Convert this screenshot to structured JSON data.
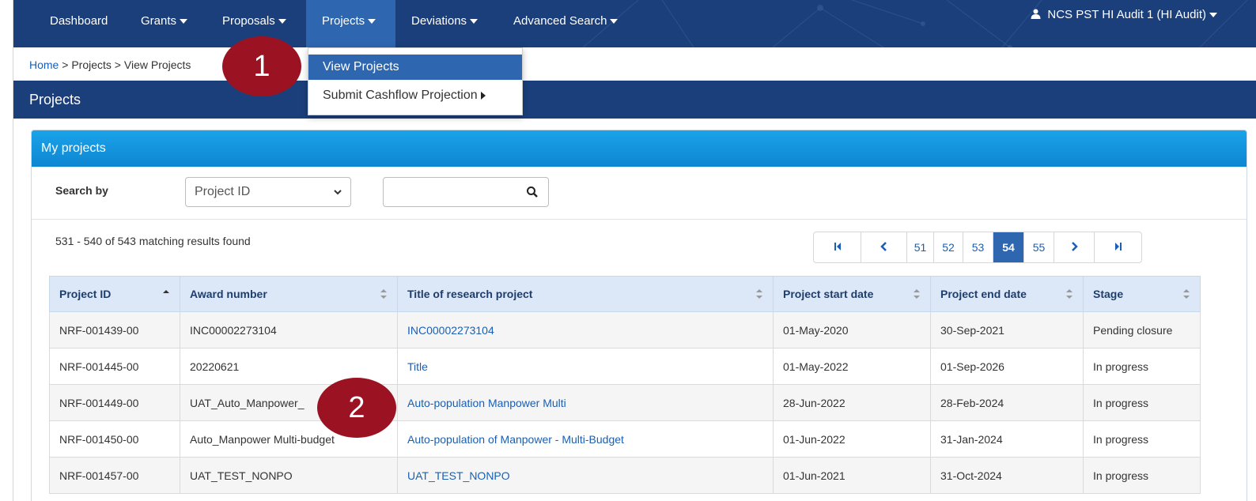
{
  "nav": {
    "items": [
      "Dashboard",
      "Grants",
      "Proposals",
      "Projects",
      "Deviations",
      "Advanced Search"
    ],
    "user": "NCS PST HI Audit 1 (HI Audit)"
  },
  "breadcrumb": {
    "home": "Home",
    "sep": ">",
    "projects": "Projects",
    "current": "View Projects"
  },
  "section_title": "Projects",
  "dropdown": {
    "items": [
      "View Projects",
      "Submit Cashflow Projection"
    ]
  },
  "markers": [
    "1",
    "2"
  ],
  "panel": {
    "title": "My projects",
    "search_label": "Search by",
    "search_by_value": "Project ID",
    "search_placeholder": "",
    "results_text": "531 - 540 of 543 matching results found"
  },
  "pager": {
    "pages": [
      "51",
      "52",
      "53",
      "54",
      "55"
    ],
    "active": "54"
  },
  "table": {
    "columns": [
      "Project ID",
      "Award number",
      "Title of research project",
      "Project start date",
      "Project end date",
      "Stage"
    ],
    "rows": [
      [
        "NRF-001439-00",
        "INC00002273104",
        "INC00002273104",
        "01-May-2020",
        "30-Sep-2021",
        "Pending closure"
      ],
      [
        "NRF-001445-00",
        "20220621",
        "Title",
        "01-May-2022",
        "01-Sep-2026",
        "In progress"
      ],
      [
        "NRF-001449-00",
        "UAT_Auto_Manpower_",
        "Auto-population Manpower Multi",
        "28-Jun-2022",
        "28-Feb-2024",
        "In progress"
      ],
      [
        "NRF-001450-00",
        "Auto_Manpower Multi-budget",
        "Auto-population of Manpower - Multi-Budget",
        "01-Jun-2022",
        "31-Jan-2024",
        "In progress"
      ],
      [
        "NRF-001457-00",
        "UAT_TEST_NONPO",
        "UAT_TEST_NONPO",
        "01-Jun-2021",
        "31-Oct-2024",
        "In progress"
      ]
    ]
  },
  "colors": {
    "navbar": "#1b3f7a",
    "nav_active": "#2e66b0",
    "panel_header": "#1aa3ea",
    "marker": "#9b1322",
    "link": "#1a5fb4"
  }
}
